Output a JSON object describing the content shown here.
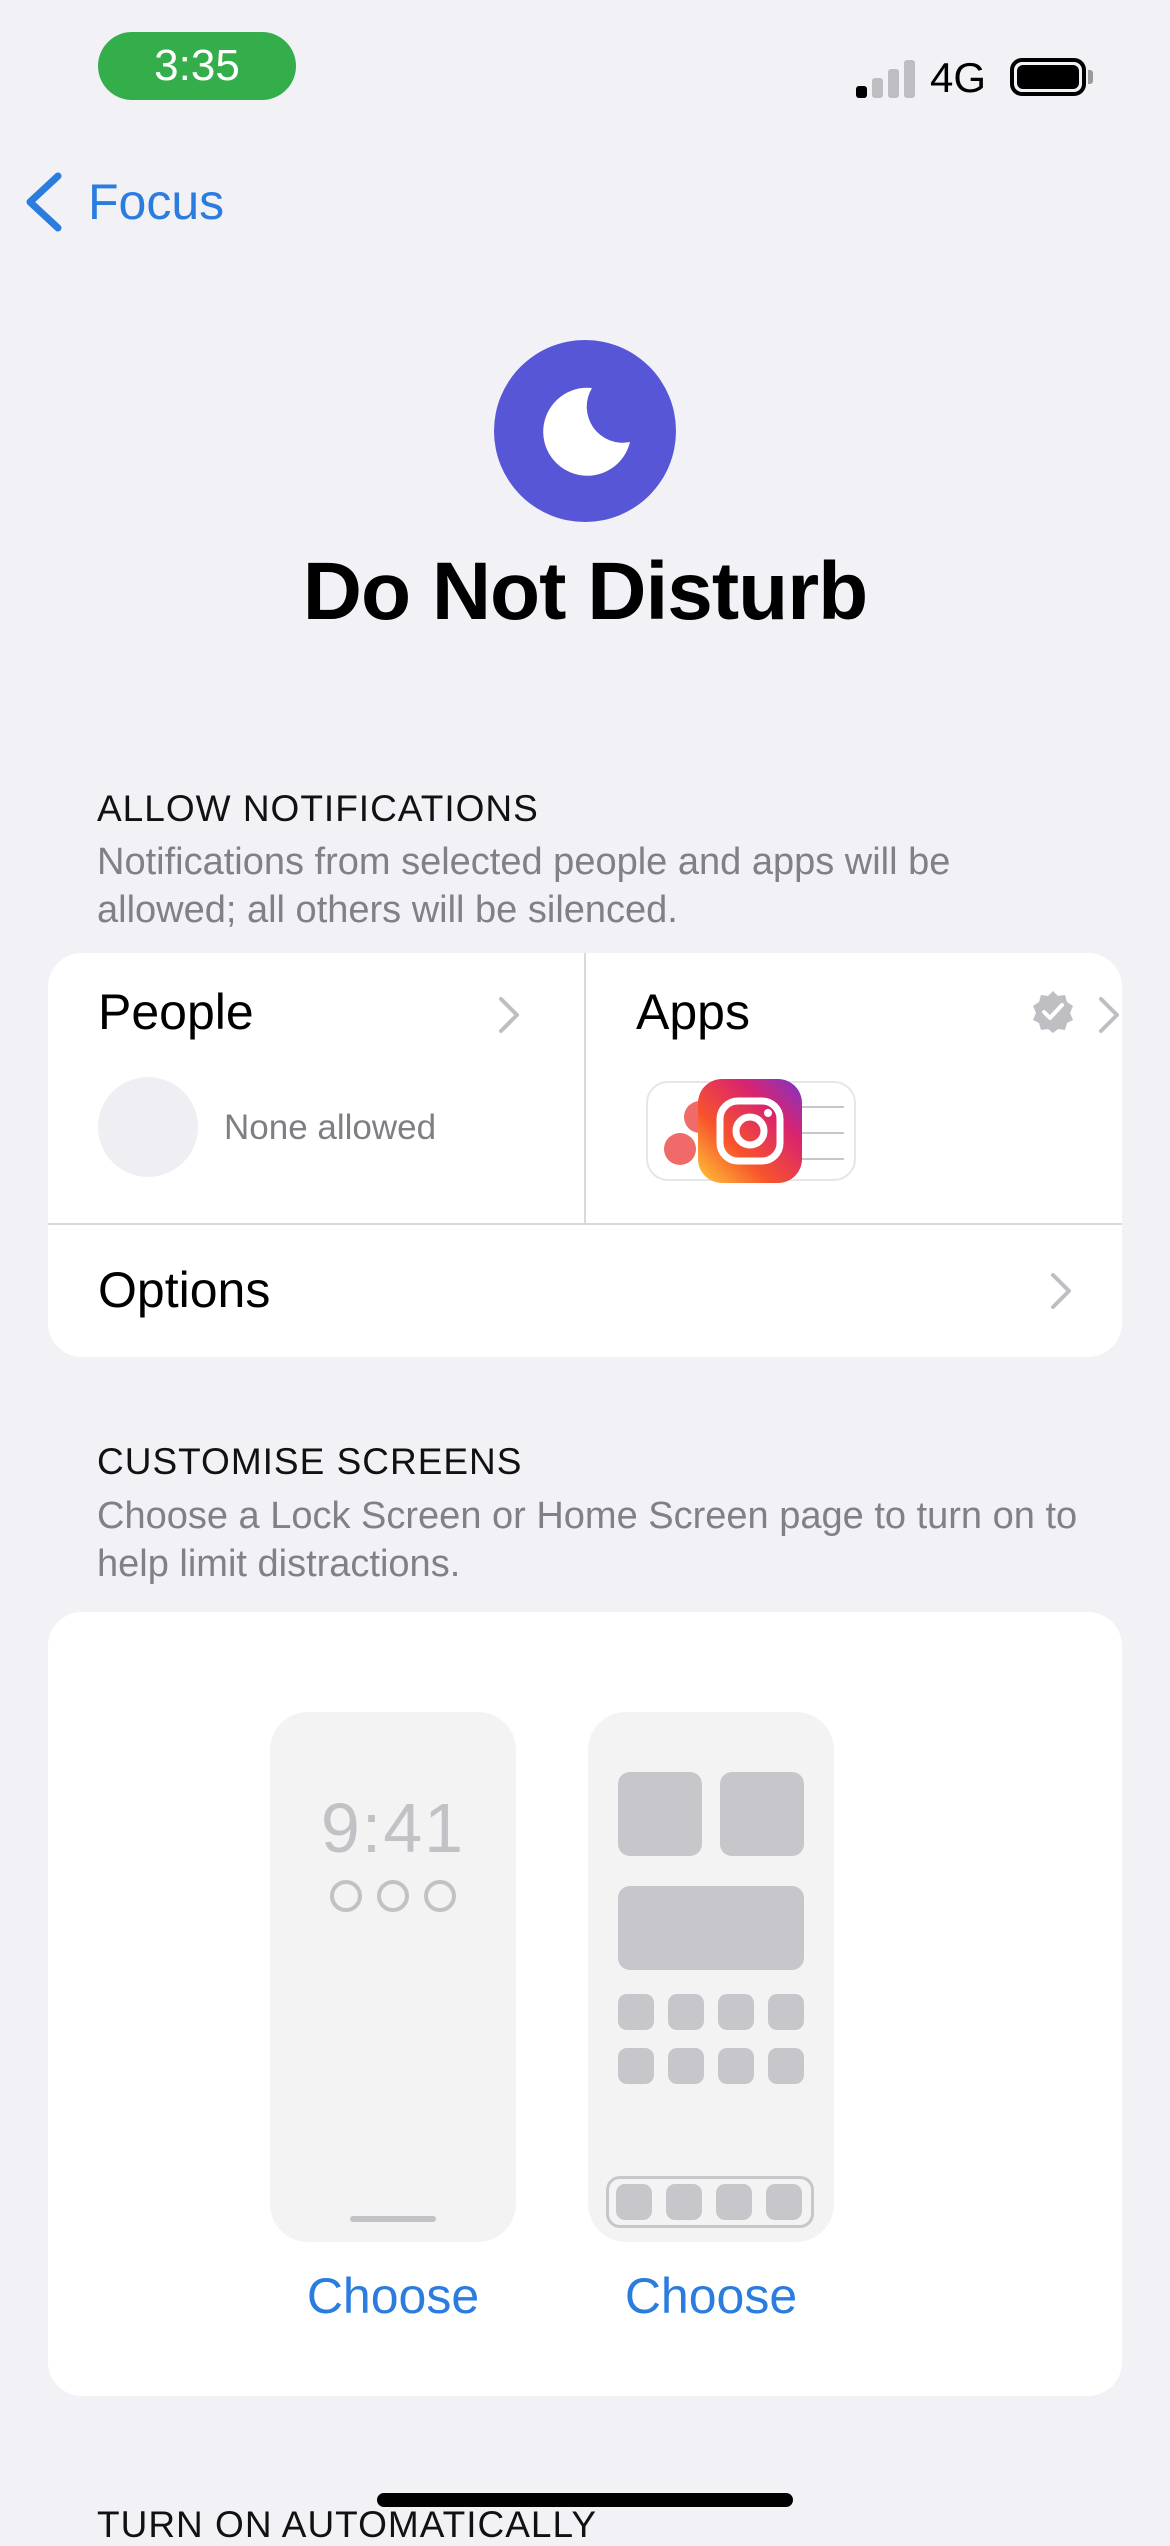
{
  "status_bar": {
    "time": "3:35",
    "network": "4G",
    "colors": {
      "time_pill": "#34AE4A"
    }
  },
  "nav": {
    "back_label": "Focus",
    "back_icon": "chevron-left-icon"
  },
  "header": {
    "icon": "moon-icon",
    "title": "Do Not Disturb",
    "icon_color": "#5756D6"
  },
  "allow_notifications": {
    "header": "ALLOW NOTIFICATIONS",
    "description": "Notifications from selected people and apps will be allowed; all others will be silenced.",
    "people": {
      "label": "People",
      "status": "None allowed"
    },
    "apps": {
      "label": "Apps",
      "badge_icon": "verified-badge-icon",
      "icons": [
        "asana-app-icon",
        "instagram-app-icon",
        "reminders-app-icon"
      ]
    },
    "options": {
      "label": "Options"
    }
  },
  "customise_screens": {
    "header": "CUSTOMISE SCREENS",
    "description": "Choose a Lock Screen or Home Screen page to turn on to help limit distractions.",
    "lock_screen": {
      "preview_time": "9:41",
      "choose_label": "Choose"
    },
    "home_screen": {
      "choose_label": "Choose"
    }
  },
  "turn_on_automatically": {
    "header": "TURN ON AUTOMATICALLY"
  },
  "accent_color": "#2A7CDF"
}
